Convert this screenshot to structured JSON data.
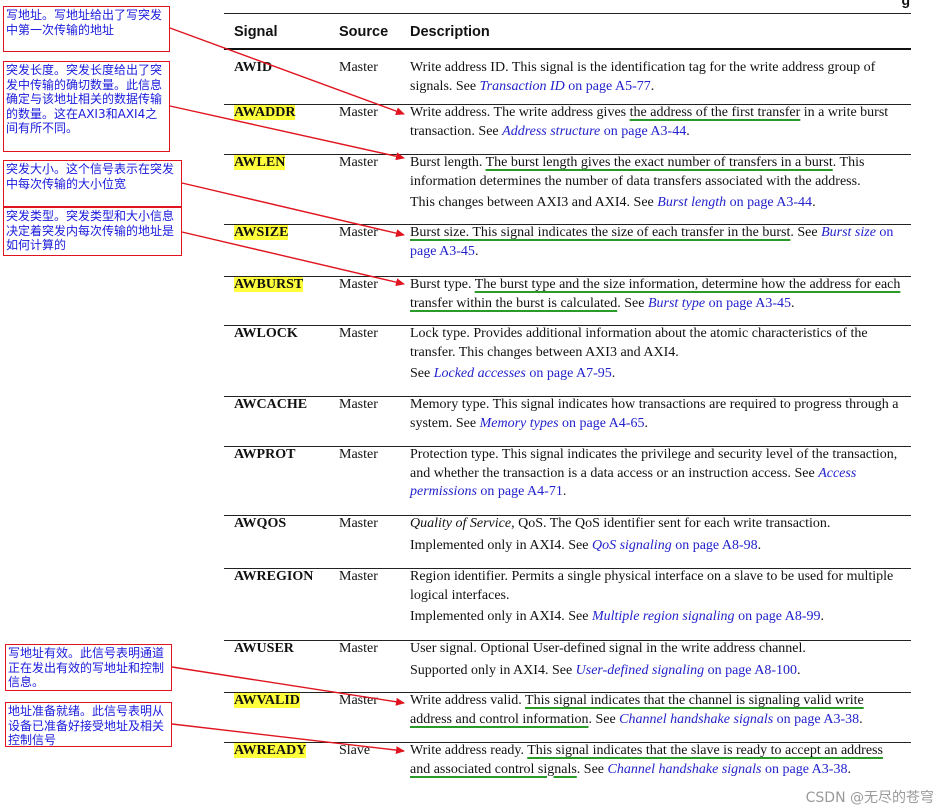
{
  "corner_text": "g",
  "headers": {
    "signal": "Signal",
    "source": "Source",
    "description": "Description"
  },
  "rows": [
    {
      "signal": "AWID",
      "highlight": false,
      "source": "Master",
      "paras": [
        [
          {
            "t": "Write address ID. This signal is the identification tag for the write address group of signals. See "
          },
          {
            "link": "Transaction ID"
          },
          {
            "link_rest": " on page A5-77"
          },
          {
            "t": "."
          }
        ]
      ]
    },
    {
      "signal": "AWADDR",
      "highlight": true,
      "source": "Master",
      "paras": [
        [
          {
            "t": "Write address. The write address gives "
          },
          {
            "u": "the address of the first transfer"
          },
          {
            "t": " in a write burst transaction. See "
          },
          {
            "link": "Address structure"
          },
          {
            "link_rest": " on page A3-44"
          },
          {
            "t": "."
          }
        ]
      ]
    },
    {
      "signal": "AWLEN",
      "highlight": true,
      "source": "Master",
      "paras": [
        [
          {
            "t": "Burst length. "
          },
          {
            "u": "The burst length gives the exact number of transfers in a burst"
          },
          {
            "t": ". This information determines the number of data transfers associated with the address."
          }
        ],
        [
          {
            "t": "This changes between AXI3 and AXI4. See "
          },
          {
            "link": "Burst length"
          },
          {
            "link_rest": " on page A3-44"
          },
          {
            "t": "."
          }
        ]
      ]
    },
    {
      "signal": "AWSIZE",
      "highlight": true,
      "source": "Master",
      "paras": [
        [
          {
            "u": "Burst size. This signal indicates the size of each transfer in the burst"
          },
          {
            "t": ". See "
          },
          {
            "link": "Burst size"
          },
          {
            "link_rest": " on page A3-45"
          },
          {
            "t": "."
          }
        ]
      ]
    },
    {
      "signal": "AWBURST",
      "highlight": true,
      "source": "Master",
      "paras": [
        [
          {
            "t": "Burst type. "
          },
          {
            "u": "The burst type and the size information, determine how the address for each transfer within the burst is calculated"
          },
          {
            "t": ". See "
          },
          {
            "link": "Burst type"
          },
          {
            "link_rest": " on page A3-45"
          },
          {
            "t": "."
          }
        ]
      ]
    },
    {
      "signal": "AWLOCK",
      "highlight": false,
      "source": "Master",
      "paras": [
        [
          {
            "t": "Lock type. Provides additional information about the atomic characteristics of the transfer. This changes between AXI3 and AXI4."
          }
        ],
        [
          {
            "t": "See "
          },
          {
            "link": "Locked accesses"
          },
          {
            "link_rest": " on page A7-95"
          },
          {
            "t": "."
          }
        ]
      ]
    },
    {
      "signal": "AWCACHE",
      "highlight": false,
      "source": "Master",
      "paras": [
        [
          {
            "t": "Memory type. This signal indicates how transactions are required to progress through a system. See "
          },
          {
            "link": "Memory types"
          },
          {
            "link_rest": " on page A4-65"
          },
          {
            "t": "."
          }
        ]
      ]
    },
    {
      "signal": "AWPROT",
      "highlight": false,
      "source": "Master",
      "paras": [
        [
          {
            "t": "Protection type. This signal indicates the privilege and security level of the transaction, and whether the transaction is a data access or an instruction access. See "
          },
          {
            "link": "Access permissions"
          },
          {
            "link_rest": " on page A4-71"
          },
          {
            "t": "."
          }
        ]
      ]
    },
    {
      "signal": "AWQOS",
      "highlight": false,
      "source": "Master",
      "paras": [
        [
          {
            "i": "Quality of Service"
          },
          {
            "t": ", QoS. The QoS identifier sent for each write transaction."
          }
        ],
        [
          {
            "t": "Implemented only in AXI4. See "
          },
          {
            "link": "QoS signaling"
          },
          {
            "link_rest": " on page A8-98"
          },
          {
            "t": "."
          }
        ]
      ]
    },
    {
      "signal": "AWREGION",
      "highlight": false,
      "source": "Master",
      "paras": [
        [
          {
            "t": "Region identifier. Permits a single physical interface on a slave to be used for multiple logical interfaces."
          }
        ],
        [
          {
            "t": "Implemented only in AXI4. See "
          },
          {
            "link": "Multiple region signaling"
          },
          {
            "link_rest": " on page A8-99"
          },
          {
            "t": "."
          }
        ]
      ]
    },
    {
      "signal": "AWUSER",
      "highlight": false,
      "source": "Master",
      "paras": [
        [
          {
            "t": "User signal. Optional User-defined signal in the write address channel."
          }
        ],
        [
          {
            "t": "Supported only in AXI4. See "
          },
          {
            "link": "User-defined signaling"
          },
          {
            "link_rest": " on page A8-100"
          },
          {
            "t": "."
          }
        ]
      ]
    },
    {
      "signal": "AWVALID",
      "highlight": true,
      "source": "Master",
      "paras": [
        [
          {
            "t": "Write address valid. "
          },
          {
            "u": "This signal indicates that the channel is signaling valid write address and control information"
          },
          {
            "t": ". See "
          },
          {
            "link": "Channel handshake signals"
          },
          {
            "link_rest": " on page A3-38"
          },
          {
            "t": "."
          }
        ]
      ]
    },
    {
      "signal": "AWREADY",
      "highlight": true,
      "source": "Slave",
      "paras": [
        [
          {
            "t": "Write address ready. "
          },
          {
            "u": "This signal indicates that the slave is ready to accept an address and associated control signals"
          },
          {
            "t": ". See "
          },
          {
            "link": "Channel handshake signals"
          },
          {
            "link_rest": " on page A3-38"
          },
          {
            "t": "."
          }
        ]
      ]
    }
  ],
  "notes": [
    "写地址。写地址给出了写突发中第一次传输的地址",
    "突发长度。突发长度给出了突发中传输的确切数量。此信息确定与该地址相关的数据传输的数量。这在AXI3和AXI4之间有所不同。",
    "突发大小。这个信号表示在突发中每次传输的大小位宽",
    "突发类型。突发类型和大小信息决定着突发内每次传输的地址是如何计算的",
    "写地址有效。此信号表明通道正在发出有效的写地址和控制信息。",
    "地址准备就绪。此信号表明从设备已准备好接受地址及相关控制信号"
  ],
  "watermark": "CSDN @无尽的苍穹",
  "colors": {
    "note_border": "#e0141e",
    "note_text": "#1a1adc",
    "link": "#2222cc",
    "highlight": "#ffff3b",
    "underline": "#2a9a2a"
  }
}
